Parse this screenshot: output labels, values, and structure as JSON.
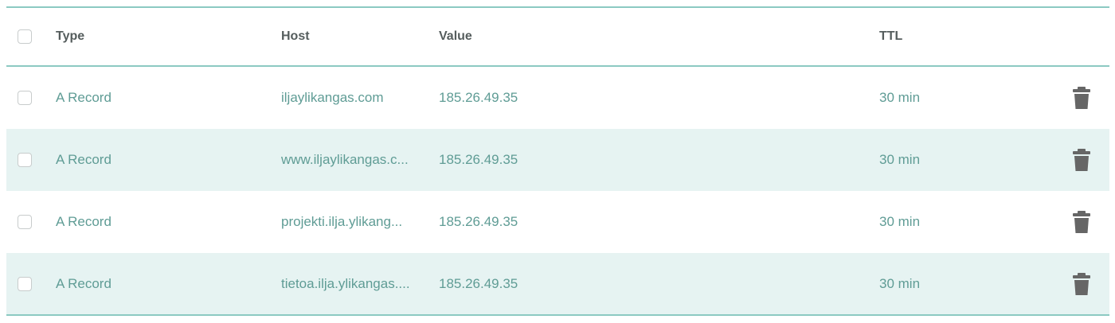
{
  "header": {
    "type": "Type",
    "host": "Host",
    "value": "Value",
    "ttl": "TTL"
  },
  "records": [
    {
      "type": "A Record",
      "host": "iljaylikangas.com",
      "value": "185.26.49.35",
      "ttl": "30 min"
    },
    {
      "type": "A Record",
      "host": "www.iljaylikangas.c...",
      "value": "185.26.49.35",
      "ttl": "30 min"
    },
    {
      "type": "A Record",
      "host": "projekti.ilja.ylikang...",
      "value": "185.26.49.35",
      "ttl": "30 min"
    },
    {
      "type": "A Record",
      "host": "tietoa.ilja.ylikangas....",
      "value": "185.26.49.35",
      "ttl": "30 min"
    }
  ],
  "icons": {
    "delete": "trash-icon"
  },
  "colors": {
    "accent": "#8cc9c2",
    "row_alt": "#e6f3f2",
    "link_text": "#5f9c95",
    "icon": "#666666"
  }
}
